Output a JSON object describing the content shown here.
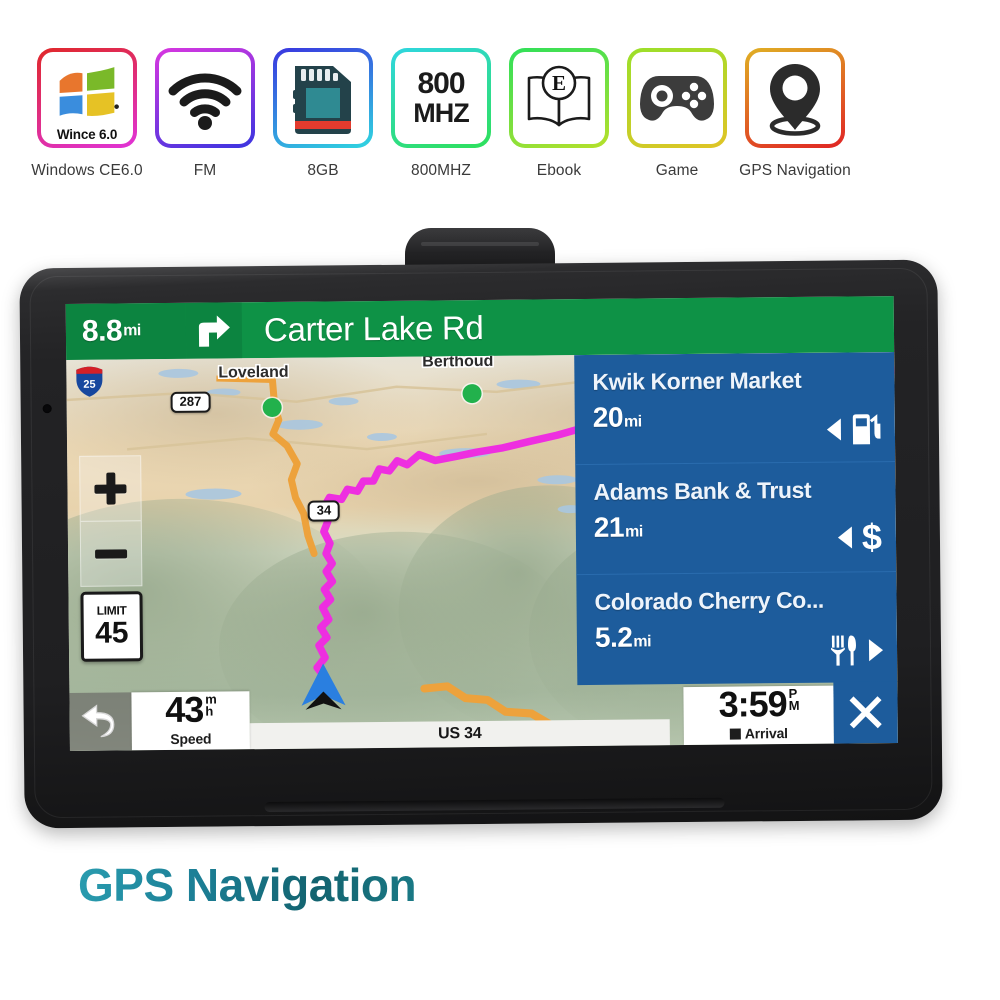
{
  "features": [
    {
      "icon": "windows-ce-logo-icon",
      "tile_text": "Wince 6.0",
      "label": "Windows CE6.0",
      "border_from": "#e02828",
      "border_to": "#e033d8"
    },
    {
      "icon": "wifi-fm-icon",
      "tile_text": "",
      "label": "FM",
      "border_from": "#d936e0",
      "border_to": "#3a35e0"
    },
    {
      "icon": "sd-card-icon",
      "tile_text": "",
      "label": "8GB",
      "border_from": "#3a35e0",
      "border_to": "#2fd6e0"
    },
    {
      "icon": "cpu-speed-icon",
      "tile_text": "800\nMHZ",
      "label": "800MHZ",
      "border_from": "#2fd6e0",
      "border_to": "#2ee05a"
    },
    {
      "icon": "ebook-icon",
      "tile_text": "E",
      "label": "Ebook",
      "border_from": "#2ee05a",
      "border_to": "#b6e02a"
    },
    {
      "icon": "gamepad-icon",
      "tile_text": "",
      "label": "Game",
      "border_from": "#9ae02a",
      "border_to": "#e0c426"
    },
    {
      "icon": "map-pin-icon",
      "tile_text": "",
      "label": "GPS Navigation",
      "border_from": "#e0b024",
      "border_to": "#e02424"
    }
  ],
  "cpu": {
    "line1": "800",
    "line2": "MHZ"
  },
  "device": {
    "nav_banner": {
      "distance": "8.8",
      "distance_unit": "mi",
      "turn_icon": "turn-right-icon",
      "street": "Carter Lake Rd"
    },
    "map": {
      "cities": [
        {
          "name": "Loveland"
        },
        {
          "name": "Berthoud"
        }
      ],
      "route_shields": [
        {
          "label": "287"
        },
        {
          "label": "34"
        }
      ],
      "interstate_shield": {
        "number": "25",
        "label": "INTERSTATE"
      },
      "zoom_in": "+",
      "zoom_out": "−",
      "speed_limit": {
        "caption": "LIMIT",
        "value": "45"
      }
    },
    "poi_panel": [
      {
        "name": "Kwik Korner Market",
        "distance": "20",
        "unit": "mi",
        "direction": "left",
        "category_icon": "fuel-pump-icon"
      },
      {
        "name": "Adams Bank & Trust",
        "distance": "21",
        "unit": "mi",
        "direction": "left",
        "category_icon": "dollar-icon"
      },
      {
        "name": "Colorado Cherry Co...",
        "distance": "5.2",
        "unit": "mi",
        "direction": "right",
        "category_icon": "restaurant-icon"
      }
    ],
    "dashboard": {
      "speed": {
        "value": "43",
        "unit_top": "m",
        "unit_bottom": "h",
        "caption": "Speed"
      },
      "current_street": "US 34",
      "arrival": {
        "value": "3:59",
        "ampm_top": "P",
        "ampm_bottom": "M",
        "caption": "Arrival"
      },
      "back_icon": "back-arrow-icon",
      "close_icon": "close-x-icon"
    }
  },
  "page_title": "GPS Navigation",
  "colors": {
    "nav_green": "#0e9246",
    "poi_blue": "#1d5c9c",
    "title_teal": "#16707f",
    "route_magenta": "#ee2ee0",
    "road_orange": "#efa13a"
  }
}
